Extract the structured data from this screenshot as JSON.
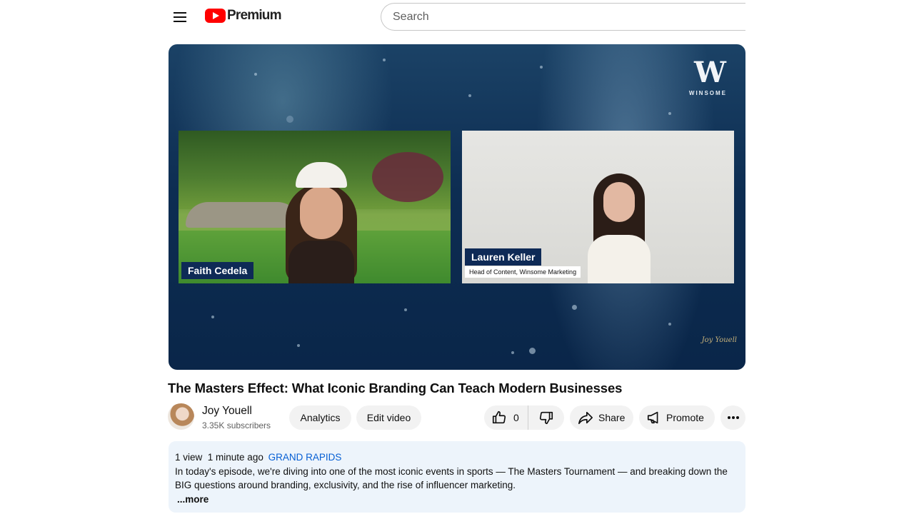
{
  "header": {
    "logo_text": "Premium",
    "search_placeholder": "Search"
  },
  "video": {
    "brand_name": "WINSOME",
    "brand_mark": "W",
    "guest_left_name": "Faith Cedela",
    "guest_right_name": "Lauren Keller",
    "guest_right_role": "Head of Content, Winsome Marketing",
    "signature": "Joy Youell"
  },
  "title": "The Masters Effect: What Iconic Branding Can Teach Modern Businesses",
  "channel": {
    "name": "Joy Youell",
    "subscribers": "3.35K subscribers"
  },
  "actions": {
    "analytics_label": "Analytics",
    "edit_label": "Edit video",
    "like_count": "0",
    "share_label": "Share",
    "promote_label": "Promote"
  },
  "description": {
    "views": "1 view",
    "time": "1 minute ago",
    "location": "GRAND RAPIDS",
    "text": "In today's episode, we're diving into one of the most iconic events in sports — The Masters Tournament — and breaking down the BIG questions around branding, exclusivity, and the rise of influencer marketing.",
    "more_label": "...more"
  },
  "colors": {
    "brand_red": "#ff0000",
    "link_blue": "#065fd4",
    "description_bg": "#edf4fb",
    "tag_navy": "#0e2a56"
  },
  "icons": [
    "menu-icon",
    "youtube-logo-icon",
    "like-icon",
    "dislike-icon",
    "share-icon",
    "promote-icon",
    "more-icon"
  ]
}
